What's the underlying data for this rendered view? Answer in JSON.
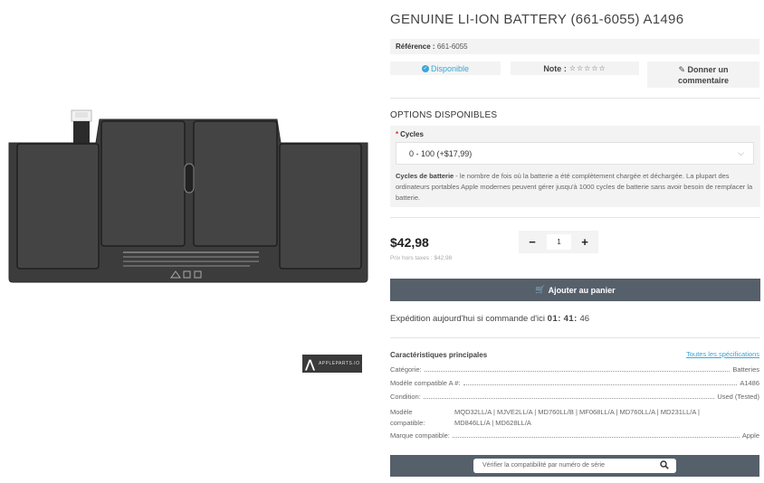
{
  "product": {
    "title": "GENUINE LI-ION BATTERY (661-6055) A1496",
    "reference_label": "Référence :",
    "reference_value": "661-6055",
    "stock_label": "Disponible",
    "rating_label": "Note :",
    "rating_stars": "☆☆☆☆☆",
    "rating_value": 0,
    "review_label_line1": "Donner un",
    "review_label_line2": "commentaire"
  },
  "image": {
    "watermark": "APPLEPARTS.IO"
  },
  "options": {
    "title": "OPTIONS DISPONIBLES",
    "required_mark": "*",
    "cycles_label": "Cycles",
    "cycles_selected": "0 - 100 (+$17,99)",
    "help_bold": "Cycles de batterie",
    "help_text": " - le nombre de fois où la batterie a été complètement chargée et déchargée. La plupart des ordinateurs portables Apple modernes peuvent gérer jusqu'à 1000 cycles de batterie sans avoir besoin de remplacer la batterie."
  },
  "pricing": {
    "price": "$42,98",
    "price_ht": "Prix hors taxes : $42,98",
    "qty_minus": "−",
    "qty_value": "1",
    "qty_plus": "+",
    "add_to_cart": "Ajouter au panier"
  },
  "shipping": {
    "text": "Expédition aujourd'hui si commande d'ici",
    "hours": "01",
    "minutes": "41",
    "seconds": "46"
  },
  "specs": {
    "title": "Caractéristiques principales",
    "all_link": "Toutes les spécifications",
    "category_label": "Catégorie:",
    "category_value": "Batteries",
    "model_label": "Modèle compatible A #:",
    "model_value": "A1486",
    "condition_label": "Condition:",
    "condition_value": "Used (Tested)",
    "compat_label_1": "Modèle",
    "compat_label_2": "compatible:",
    "compat_value_1": "MQD32LL/A | MJVE2LL/A | MD760LL/B | MF068LL/A | MD760LL/A | MD231LL/A |",
    "compat_value_2": "MD846LL/A | MD628LL/A",
    "brand_label": "Marque compatible:",
    "brand_value": "Apple"
  },
  "verify": {
    "placeholder": "Vérifier la compatibilité par numéro de série"
  },
  "colors": {
    "accent": "#3aa7d8",
    "button_bg": "#56606b",
    "panel_bg": "#f3f3f3",
    "required": "#d9302c"
  }
}
